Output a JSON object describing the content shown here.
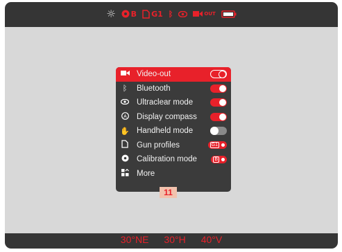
{
  "statusbar": {
    "brightness_icon": "sun-icon",
    "calibration_label": "B",
    "gun_profile_label": "G1",
    "bluetooth_icon": "bluetooth-icon",
    "ultraclear_icon": "eye-icon",
    "videoout_label": "OUT",
    "battery_icon": "battery-icon"
  },
  "menu": {
    "items": [
      {
        "label": "Video-out",
        "icon": "video-out-icon",
        "control": "toggle-outline",
        "active": true
      },
      {
        "label": "Bluetooth",
        "icon": "bluetooth-icon",
        "control": "toggle-on"
      },
      {
        "label": "Ultraclear mode",
        "icon": "eye-icon",
        "control": "toggle-on"
      },
      {
        "label": "Display compass",
        "icon": "compass-icon",
        "control": "toggle-on"
      },
      {
        "label": "Handheld mode",
        "icon": "hand-icon",
        "control": "toggle-off"
      },
      {
        "label": "Gun profiles",
        "icon": "gun-profile-icon",
        "control": "pill",
        "value": "G1"
      },
      {
        "label": "Calibration mode",
        "icon": "calibration-icon",
        "control": "pill",
        "value": "B"
      },
      {
        "label": "More",
        "icon": "more-icon",
        "control": "none"
      }
    ]
  },
  "badge": "11",
  "bottombar": {
    "heading": "30°NE",
    "horizontal": "30°H",
    "vertical": "40°V"
  },
  "colors": {
    "accent": "#e8212a",
    "frame": "#353535",
    "screen": "#d8d8d8",
    "menu": "#3b3b3b"
  }
}
